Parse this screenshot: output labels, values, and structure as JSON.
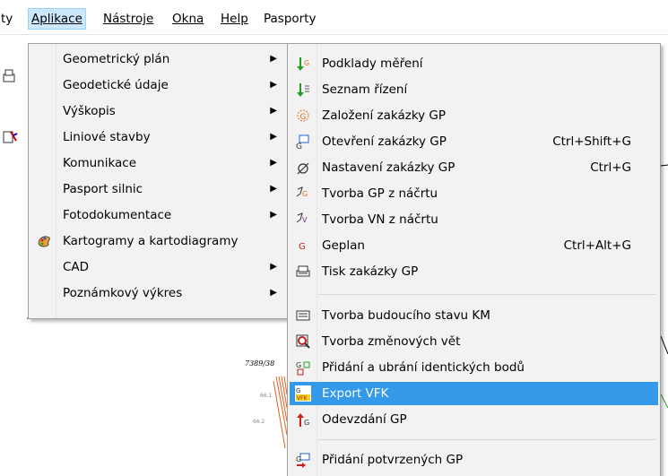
{
  "menubar": {
    "items": [
      {
        "label": "ty"
      },
      {
        "label": "Aplikace"
      },
      {
        "label": "Nástroje"
      },
      {
        "label": "Okna"
      },
      {
        "label": "Help"
      },
      {
        "label": "Pasporty"
      }
    ]
  },
  "aplikace_menu": {
    "items": [
      {
        "label": "Geometrický plán",
        "submenu": true
      },
      {
        "label": "Geodetické údaje",
        "submenu": true
      },
      {
        "label": "Výškopis",
        "submenu": true
      },
      {
        "label": "Liniové stavby",
        "submenu": true
      },
      {
        "label": "Komunikace",
        "submenu": true
      },
      {
        "label": "Pasport silnic",
        "submenu": true
      },
      {
        "label": "Fotodokumentace",
        "submenu": true
      },
      {
        "label": "Kartogramy a kartodiagramy",
        "icon": "palette-icon"
      },
      {
        "label": "CAD",
        "submenu": true
      },
      {
        "label": "Poznámkový výkres",
        "submenu": true
      }
    ]
  },
  "gp_submenu": {
    "items": [
      {
        "label": "Podklady měření",
        "icon": "survey-data-icon"
      },
      {
        "label": "Seznam řízení",
        "icon": "list-icon"
      },
      {
        "label": "Založení zakázky GP",
        "icon": "new-order-icon"
      },
      {
        "label": "Otevření zakázky GP",
        "shortcut": "Ctrl+Shift+G",
        "icon": "open-order-icon"
      },
      {
        "label": "Nastavení zakázky GP",
        "shortcut": "Ctrl+G",
        "icon": "settings-order-icon"
      },
      {
        "label": "Tvorba GP z náčrtu",
        "icon": "gp-from-sketch-icon"
      },
      {
        "label": "Tvorba VN z náčrtu",
        "icon": "vn-from-sketch-icon"
      },
      {
        "label": "Geplan",
        "shortcut": "Ctrl+Alt+G",
        "icon": "geplan-icon"
      },
      {
        "label": "Tisk zakázky GP",
        "icon": "print-icon"
      },
      {
        "label": "Tvorba budoucího stavu KM",
        "icon": "future-state-icon"
      },
      {
        "label": "Tvorba změnových vět",
        "icon": "change-records-icon"
      },
      {
        "label": "Přidání a ubrání identických bodů",
        "icon": "identical-points-icon"
      },
      {
        "label": "Export VFK",
        "icon": "export-vfk-icon",
        "highlighted": true
      },
      {
        "label": "Odevzdání GP",
        "icon": "submit-gp-icon"
      },
      {
        "label": "Přidání potvrzených GP",
        "icon": "add-confirmed-icon"
      }
    ]
  },
  "map": {
    "parcel_label": "7389/38"
  },
  "colors": {
    "highlight": "#3399e8",
    "menubar_open": "#cce8ff",
    "menu_bg": "#f2f2f2"
  }
}
